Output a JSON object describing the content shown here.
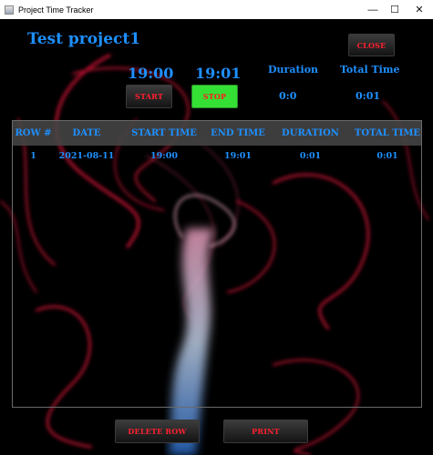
{
  "window": {
    "title": "Project Time Tracker",
    "controls": {
      "minimize": "—",
      "maximize": "☐",
      "close": "✕"
    }
  },
  "project": {
    "name": "Test project1"
  },
  "buttons": {
    "close": "CLOSE",
    "start": "START",
    "stop": "STOP",
    "delete_row": "DELETE ROW",
    "print": "PRINT"
  },
  "timer": {
    "start_time": "19:00",
    "end_time": "19:01",
    "duration_label": "Duration",
    "duration_value": "0:0",
    "total_label": "Total Time",
    "total_value": "0:01"
  },
  "table": {
    "headers": [
      "ROW #",
      "DATE",
      "START TIME",
      "END TIME",
      "DURATION",
      "TOTAL TIME"
    ],
    "rows": [
      [
        "1",
        "2021-08-11",
        "19:00",
        "19:01",
        "0:01",
        "0:01"
      ]
    ]
  },
  "colors": {
    "accent": "#1e90ff",
    "button_text": "#ff2030",
    "stop_button": "#35e035",
    "background": "#000000"
  }
}
